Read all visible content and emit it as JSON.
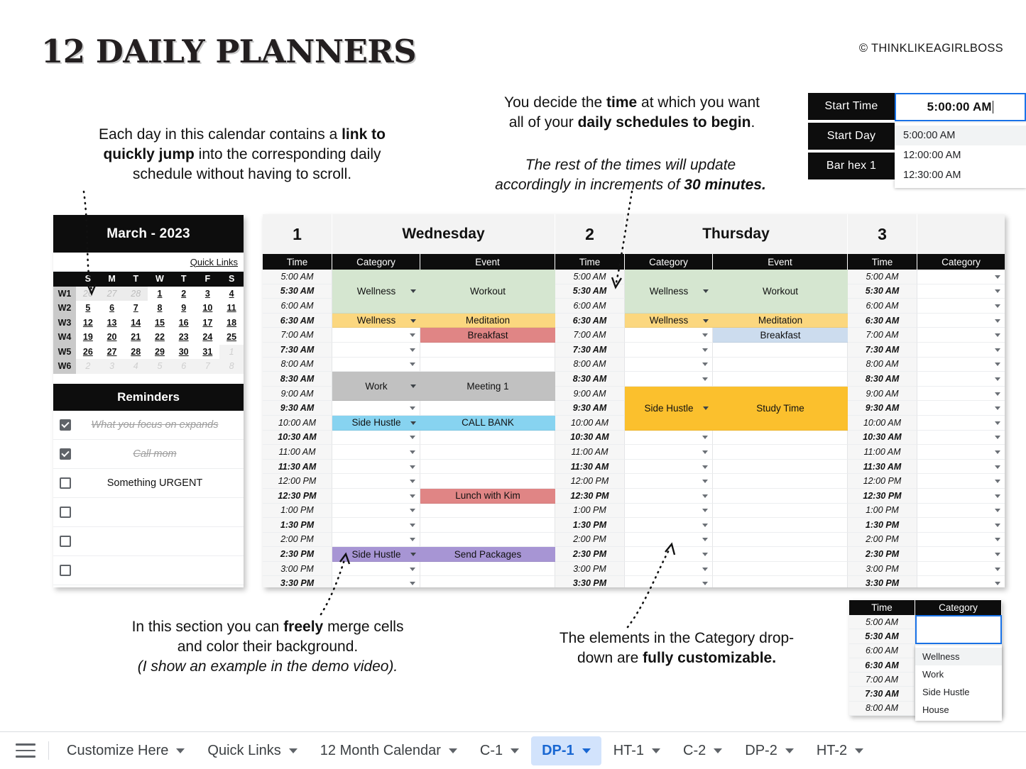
{
  "title": "12 DAILY PLANNERS",
  "copyright": "© THINKLIKEAGIRLBOSS",
  "callouts": {
    "calendar": {
      "l1_a": "Each day in this calendar contains a ",
      "l1_b": "link to",
      "l2_b": "quickly jump",
      "l2_a": " into the corresponding daily",
      "l3": "schedule without having to scroll."
    },
    "start_time": {
      "l1_a": "You decide the ",
      "l1_b": "time",
      "l1_c": " at which you want",
      "l2_a": "all of your ",
      "l2_b": "daily schedules to begin",
      "l2_c": "."
    },
    "increments": {
      "l1": "The rest of the times will update",
      "l2_a": "accordingly in increments of ",
      "l2_b": "30 minutes."
    },
    "merge": {
      "l1_a": "In this section you can ",
      "l1_b": "freely",
      "l1_c": " merge cells",
      "l2": "and color their background.",
      "l3": "(I show an example in the demo video)."
    },
    "category": {
      "l1": "The elements in the Category drop-",
      "l2_a": "down are ",
      "l2_b": "fully customizable."
    }
  },
  "start_time_panel": {
    "labels": [
      "Start Time",
      "Start Day",
      "Bar hex 1"
    ],
    "value": "5:00:00 AM",
    "options": [
      "5:00:00 AM",
      "12:00:00 AM",
      "12:30:00 AM"
    ],
    "selected_option": "5:00:00 AM"
  },
  "calendar": {
    "title": "March - 2023",
    "quick_links": "Quick Links",
    "weekday_headers": [
      "",
      "S",
      "M",
      "T",
      "W",
      "T",
      "F",
      "S"
    ],
    "weeks": [
      {
        "label": "W1",
        "days": [
          {
            "n": "26",
            "state": "prev"
          },
          {
            "n": "27",
            "state": "prev"
          },
          {
            "n": "28",
            "state": "prev"
          },
          {
            "n": "1",
            "state": "cur"
          },
          {
            "n": "2",
            "state": "cur"
          },
          {
            "n": "3",
            "state": "cur"
          },
          {
            "n": "4",
            "state": "cur"
          }
        ]
      },
      {
        "label": "W2",
        "days": [
          {
            "n": "5",
            "state": "cur"
          },
          {
            "n": "6",
            "state": "cur"
          },
          {
            "n": "7",
            "state": "cur"
          },
          {
            "n": "8",
            "state": "cur"
          },
          {
            "n": "9",
            "state": "cur"
          },
          {
            "n": "10",
            "state": "cur"
          },
          {
            "n": "11",
            "state": "cur"
          }
        ]
      },
      {
        "label": "W3",
        "days": [
          {
            "n": "12",
            "state": "cur"
          },
          {
            "n": "13",
            "state": "cur"
          },
          {
            "n": "14",
            "state": "cur"
          },
          {
            "n": "15",
            "state": "cur"
          },
          {
            "n": "16",
            "state": "cur"
          },
          {
            "n": "17",
            "state": "cur"
          },
          {
            "n": "18",
            "state": "cur"
          }
        ]
      },
      {
        "label": "W4",
        "days": [
          {
            "n": "19",
            "state": "cur"
          },
          {
            "n": "20",
            "state": "cur"
          },
          {
            "n": "21",
            "state": "cur"
          },
          {
            "n": "22",
            "state": "cur"
          },
          {
            "n": "23",
            "state": "cur"
          },
          {
            "n": "24",
            "state": "cur"
          },
          {
            "n": "25",
            "state": "cur"
          }
        ]
      },
      {
        "label": "W5",
        "days": [
          {
            "n": "26",
            "state": "cur"
          },
          {
            "n": "27",
            "state": "cur"
          },
          {
            "n": "28",
            "state": "cur"
          },
          {
            "n": "29",
            "state": "cur"
          },
          {
            "n": "30",
            "state": "cur"
          },
          {
            "n": "31",
            "state": "cur"
          },
          {
            "n": "1",
            "state": "next"
          }
        ]
      },
      {
        "label": "W6",
        "days": [
          {
            "n": "2",
            "state": "next"
          },
          {
            "n": "3",
            "state": "next"
          },
          {
            "n": "4",
            "state": "next"
          },
          {
            "n": "5",
            "state": "next"
          },
          {
            "n": "6",
            "state": "next"
          },
          {
            "n": "7",
            "state": "next"
          },
          {
            "n": "8",
            "state": "next"
          }
        ]
      }
    ]
  },
  "reminders": {
    "title": "Reminders",
    "items": [
      {
        "text": "What you focus on expands",
        "checked": true
      },
      {
        "text": "Call mom",
        "checked": true
      },
      {
        "text": "Something URGENT",
        "checked": false
      },
      {
        "text": "",
        "checked": false
      },
      {
        "text": "",
        "checked": false
      },
      {
        "text": "",
        "checked": false
      }
    ]
  },
  "schedule": {
    "column_headers": [
      "Time",
      "Category",
      "Event"
    ],
    "days": [
      {
        "number": "1",
        "name": "Wednesday"
      },
      {
        "number": "2",
        "name": "Thursday"
      },
      {
        "number": "3",
        "name": ""
      }
    ],
    "times": [
      "5:00 AM",
      "5:30 AM",
      "6:00 AM",
      "6:30 AM",
      "7:00 AM",
      "7:30 AM",
      "8:00 AM",
      "8:30 AM",
      "9:00 AM",
      "9:30 AM",
      "10:00 AM",
      "10:30 AM",
      "11:00 AM",
      "11:30 AM",
      "12:00 PM",
      "12:30 PM",
      "1:00 PM",
      "1:30 PM",
      "2:00 PM",
      "2:30 PM",
      "3:00 PM",
      "3:30 PM"
    ],
    "day1_blocks": [
      {
        "start": 0,
        "span": 3,
        "category": "Wellness",
        "event": "Workout",
        "color": "#d5e6d0",
        "event_color": "#d5e6d0"
      },
      {
        "start": 3,
        "span": 1,
        "category": "Wellness",
        "event": "Meditation",
        "color": "#fbd77f",
        "event_color": "#fbd77f"
      },
      {
        "start": 4,
        "span": 1,
        "category": "",
        "event": "Breakfast",
        "color": "",
        "event_color": "#e08585"
      },
      {
        "start": 7,
        "span": 2,
        "category": "Work",
        "event": "Meeting 1",
        "color": "#c1c1c1",
        "event_color": "#c1c1c1"
      },
      {
        "start": 10,
        "span": 1,
        "category": "Side Hustle",
        "event": "CALL BANK",
        "color": "#87d3f0",
        "event_color": "#87d3f0"
      },
      {
        "start": 15,
        "span": 1,
        "category": "",
        "event": "Lunch with Kim",
        "color": "",
        "event_color": "#e08585"
      },
      {
        "start": 19,
        "span": 1,
        "category": "Side Hustle",
        "event": "Send Packages",
        "color": "#a795d4",
        "event_color": "#a795d4"
      }
    ],
    "day2_blocks": [
      {
        "start": 0,
        "span": 3,
        "category": "Wellness",
        "event": "Workout",
        "color": "#d5e6d0",
        "event_color": "#d5e6d0"
      },
      {
        "start": 3,
        "span": 1,
        "category": "Wellness",
        "event": "Meditation",
        "color": "#fbd77f",
        "event_color": "#fbd77f"
      },
      {
        "start": 4,
        "span": 1,
        "category": "",
        "event": "Breakfast",
        "color": "",
        "event_color": "#ccdcee"
      },
      {
        "start": 8,
        "span": 3,
        "category": "Side Hustle",
        "event": "Study Time",
        "color": "#fbc02d",
        "event_color": "#fbc02d"
      }
    ],
    "day3_blocks": []
  },
  "category_panel": {
    "headers": [
      "Time",
      "Category"
    ],
    "times": [
      "5:00 AM",
      "5:30 AM",
      "6:00 AM",
      "6:30 AM",
      "7:00 AM",
      "7:30 AM",
      "8:00 AM"
    ],
    "options": [
      "Wellness",
      "Work",
      "Side Hustle",
      "House"
    ],
    "highlighted": "Wellness"
  },
  "tabs": [
    {
      "label": "Customize Here",
      "active": false
    },
    {
      "label": "Quick Links",
      "active": false
    },
    {
      "label": "12 Month Calendar",
      "active": false
    },
    {
      "label": "C-1",
      "active": false
    },
    {
      "label": "DP-1",
      "active": true
    },
    {
      "label": "HT-1",
      "active": false
    },
    {
      "label": "C-2",
      "active": false
    },
    {
      "label": "DP-2",
      "active": false
    },
    {
      "label": "HT-2",
      "active": false
    }
  ],
  "colors": {
    "accent_blue": "#1a73e8",
    "active_tab_bg": "#d2e3fc",
    "header_black": "#0d0d0d"
  }
}
